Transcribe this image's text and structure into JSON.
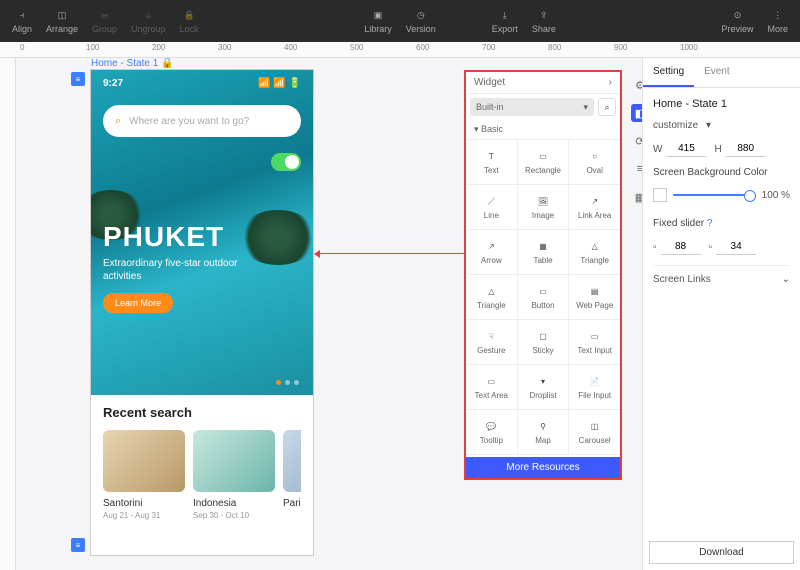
{
  "toolbar": {
    "groups_left": [
      {
        "id": "align",
        "label": "Align"
      },
      {
        "id": "arrange",
        "label": "Arrange"
      },
      {
        "id": "group",
        "label": "Group",
        "dim": true
      },
      {
        "id": "ungroup",
        "label": "Ungroup",
        "dim": true
      },
      {
        "id": "lock",
        "label": "Lock",
        "dim": true
      }
    ],
    "groups_mid": [
      {
        "id": "library",
        "label": "Library"
      },
      {
        "id": "version",
        "label": "Version"
      }
    ],
    "groups_mid2": [
      {
        "id": "export",
        "label": "Export"
      },
      {
        "id": "share",
        "label": "Share"
      }
    ],
    "groups_right": [
      {
        "id": "preview",
        "label": "Preview"
      },
      {
        "id": "more",
        "label": "More"
      }
    ]
  },
  "ruler": {
    "ticks": [
      "0",
      "100",
      "200",
      "300",
      "400",
      "500",
      "600",
      "700",
      "800",
      "900",
      "1000"
    ]
  },
  "artboard_label": "Home - State 1",
  "mockup": {
    "time": "9:27",
    "search_placeholder": "Where are you want to go?",
    "hero_title": "PHUKET",
    "hero_subtitle": "Extraordinary five-star outdoor activities",
    "learn_more": "Learn More",
    "recent_title": "Recent search",
    "cards": [
      {
        "name": "Santorini",
        "date": "Aug 21 - Aug 31"
      },
      {
        "name": "Indonesia",
        "date": "Sep 30 - Oct 10"
      },
      {
        "name": "Paris",
        "date": ""
      }
    ]
  },
  "widget_panel": {
    "title": "Widget",
    "filter": "Built-in",
    "category": "Basic",
    "items": [
      [
        {
          "n": "Text"
        },
        {
          "n": "Rectangle"
        },
        {
          "n": "Oval"
        }
      ],
      [
        {
          "n": "Line"
        },
        {
          "n": "Image"
        },
        {
          "n": "Link Area"
        }
      ],
      [
        {
          "n": "Arrow"
        },
        {
          "n": "Table"
        },
        {
          "n": "Triangle"
        }
      ],
      [
        {
          "n": "Triangle"
        },
        {
          "n": "Button"
        },
        {
          "n": "Web Page"
        }
      ],
      [
        {
          "n": "Gesture"
        },
        {
          "n": "Sticky"
        },
        {
          "n": "Text Input"
        }
      ],
      [
        {
          "n": "Text Area"
        },
        {
          "n": "Droplist"
        },
        {
          "n": "File Input"
        }
      ],
      [
        {
          "n": "Tooltip"
        },
        {
          "n": "Map"
        },
        {
          "n": "Carousel"
        }
      ]
    ],
    "more": "More Resources"
  },
  "right_panel": {
    "tab_setting": "Setting",
    "tab_event": "Event",
    "title": "Home - State 1",
    "customize": "customize",
    "w_label": "W",
    "w_value": "415",
    "h_label": "H",
    "h_value": "880",
    "bg_label": "Screen Background Color",
    "bg_pct": "100 %",
    "slider_label": "Fixed slider",
    "slider_v1": "88",
    "slider_v2": "34",
    "links_label": "Screen Links",
    "download": "Download"
  }
}
